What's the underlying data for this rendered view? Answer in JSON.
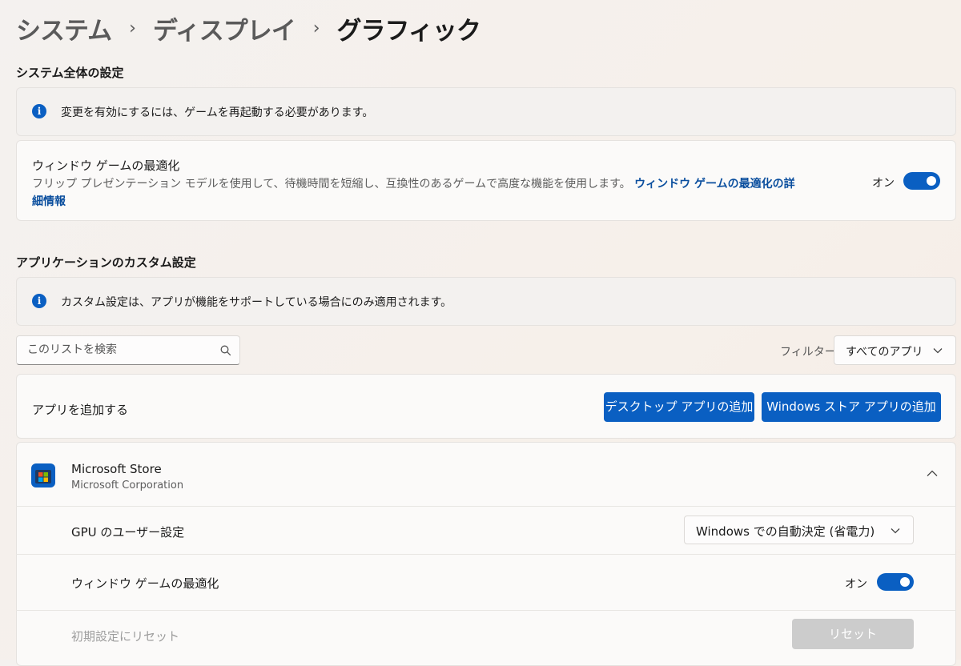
{
  "breadcrumb": {
    "item1": "システム",
    "item2": "ディスプレイ",
    "current": "グラフィック",
    "separator": "›"
  },
  "system_section": {
    "title": "システム全体の設定",
    "info_text": "変更を有効にするには、ゲームを再起動する必要があります。",
    "windowed_opt": {
      "title": "ウィンドウ ゲームの最適化",
      "description": "フリップ プレゼンテーション モデルを使用して、待機時間を短縮し、互換性のあるゲームで高度な機能を使用します。",
      "link_line1": "ウィンドウ ゲームの最適化の詳",
      "link_line2": "細情報",
      "state": "オン",
      "enabled": true
    }
  },
  "app_section": {
    "title": "アプリケーションのカスタム設定",
    "info_text": "カスタム設定は、アプリが機能をサポートしている場合にのみ適用されます。",
    "search_placeholder": "このリストを検索",
    "filter_label": "フィルター:",
    "filter_value": "すべてのアプリ",
    "add_app_label": "アプリを追加する",
    "desktop_button": "デスクトップ アプリの追加",
    "store_button": "Windows ストア アプリの追加"
  },
  "app": {
    "name": "Microsoft Store",
    "publisher": "Microsoft Corporation",
    "gpu_label": "GPU のユーザー設定",
    "gpu_value": "Windows での自動決定 (省電力)",
    "windowed_label": "ウィンドウ ゲームの最適化",
    "windowed_state": "オン",
    "windowed_enabled": true,
    "reset_label": "初期設定にリセット",
    "reset_button": "リセット"
  },
  "colors": {
    "accent": "#0a5fc2",
    "disabled_button": "#cccccc"
  }
}
